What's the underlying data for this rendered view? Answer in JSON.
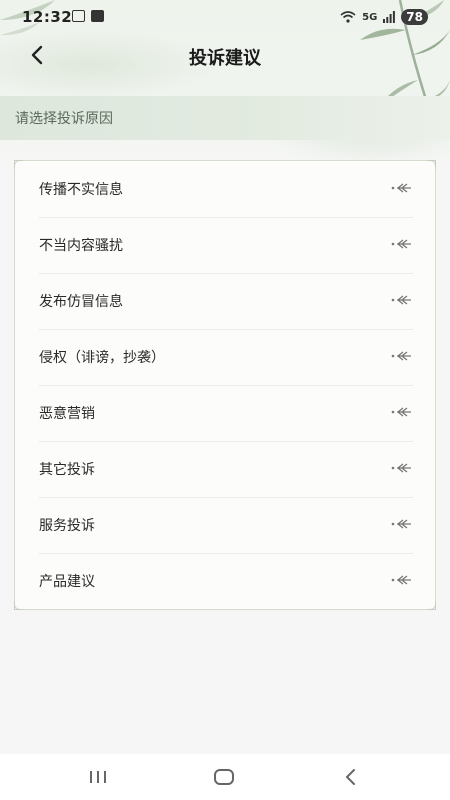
{
  "status_bar": {
    "time": "12:32",
    "signal_label": "5G",
    "battery": "78"
  },
  "header": {
    "title": "投诉建议"
  },
  "section": {
    "label": "请选择投诉原因"
  },
  "complaint_reasons": [
    {
      "label": "传播不实信息"
    },
    {
      "label": "不当内容骚扰"
    },
    {
      "label": "发布仿冒信息"
    },
    {
      "label": "侵权（诽谤，抄袭）"
    },
    {
      "label": "恶意营销"
    },
    {
      "label": "其它投诉"
    },
    {
      "label": "服务投诉"
    },
    {
      "label": "产品建议"
    }
  ],
  "colors": {
    "accent_green": "#5b6a5b",
    "card_border": "#d4dccf",
    "section_bg": "#dde7dc"
  }
}
